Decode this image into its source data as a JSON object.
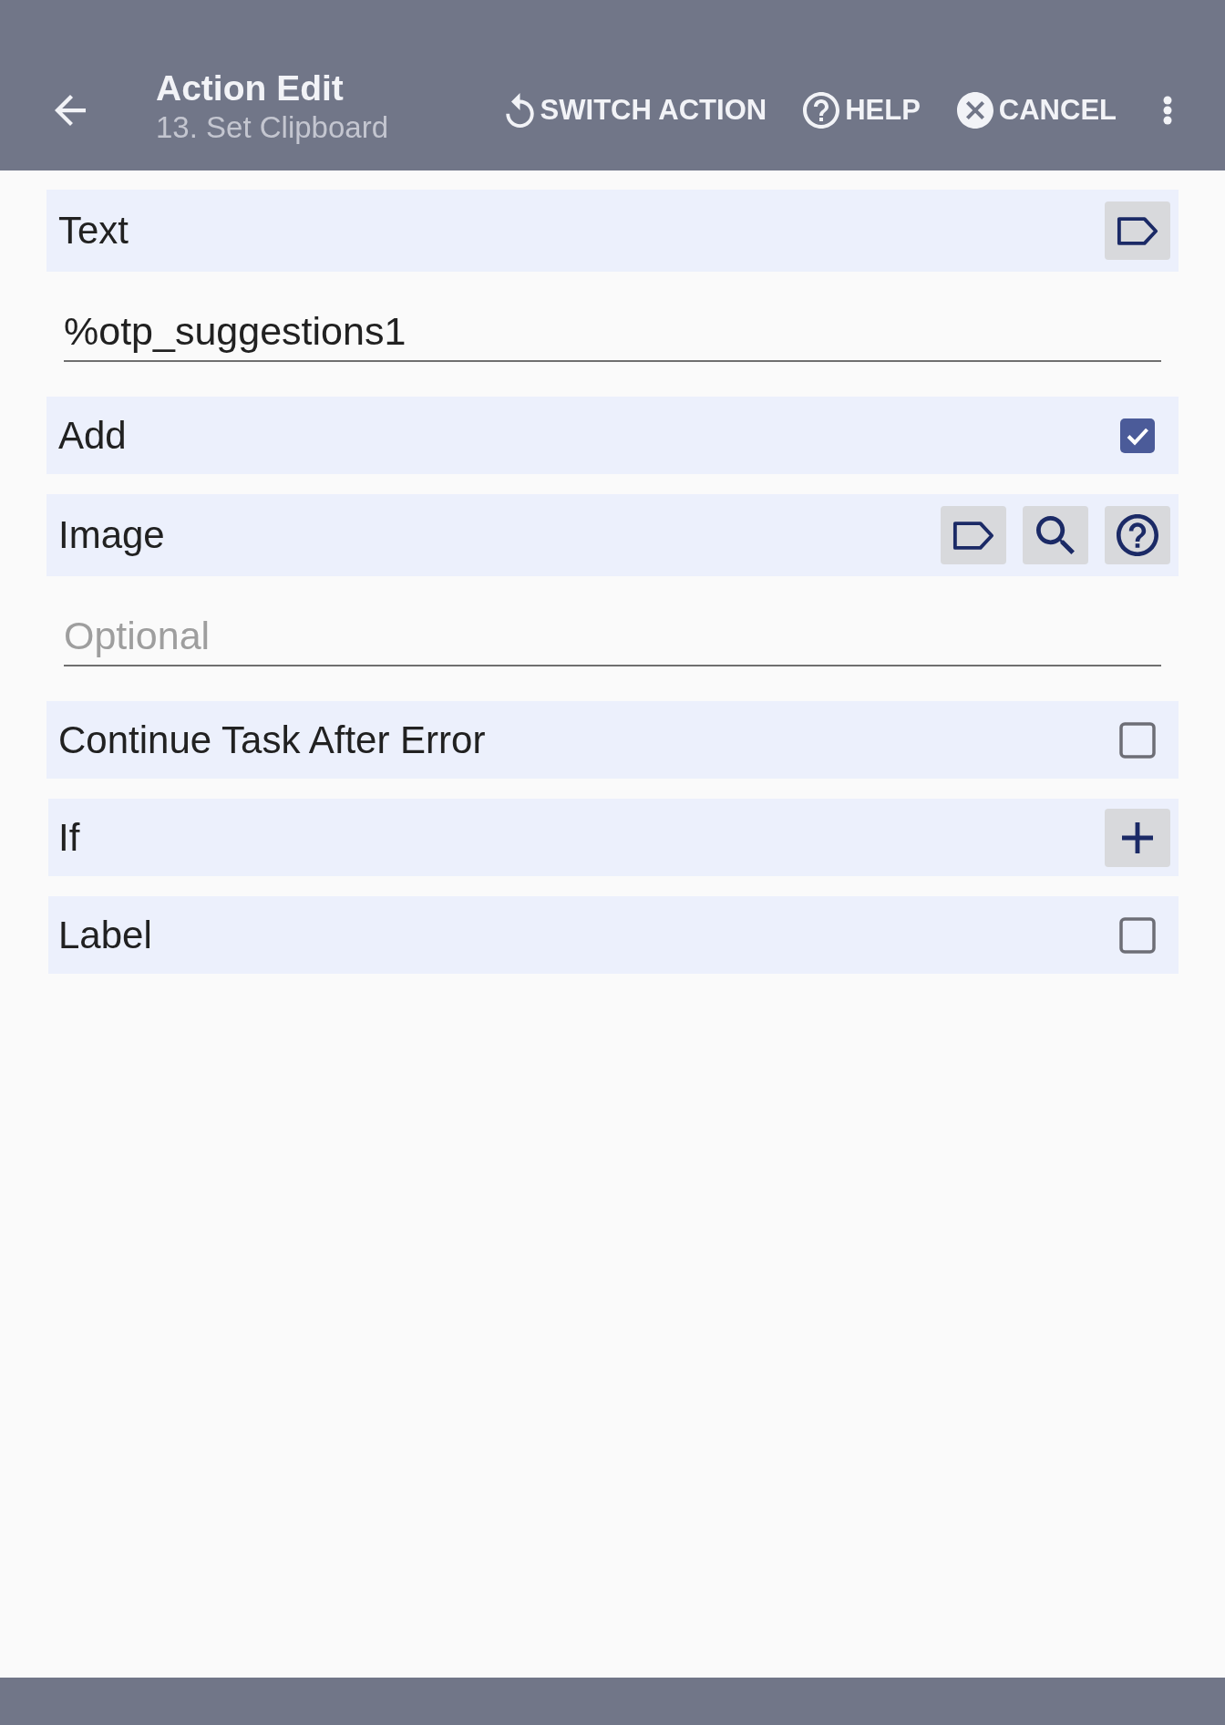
{
  "app_bar": {
    "title": "Action Edit",
    "subtitle": "13. Set Clipboard",
    "actions": [
      {
        "kind": "switch",
        "label": "SWITCH ACTION"
      },
      {
        "kind": "help",
        "label": "HELP"
      },
      {
        "kind": "cancel",
        "label": "CANCEL"
      }
    ]
  },
  "params": [
    {
      "kind": "text",
      "label": "Text",
      "value": "%otp_suggestions1"
    },
    {
      "kind": "checkbox",
      "label": "Add",
      "checked": true
    },
    {
      "kind": "image",
      "label": "Image",
      "placeholder": "Optional"
    },
    {
      "kind": "checkbox",
      "label": "Continue Task After Error",
      "checked": false
    },
    {
      "kind": "condition",
      "label": "If"
    },
    {
      "kind": "checkbox",
      "label": "Label",
      "checked": false
    }
  ]
}
